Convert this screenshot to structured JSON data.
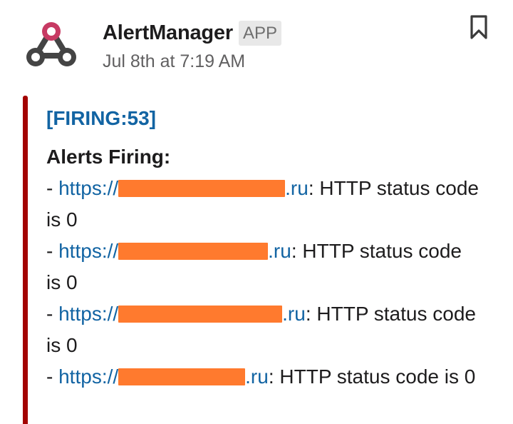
{
  "message": {
    "sender": "AlertManager",
    "badge": "APP",
    "timestamp": "Jul 8th at 7:19 AM"
  },
  "icons": {
    "avatar": "webhook-logo-icon",
    "bookmark": "bookmark-icon"
  },
  "colors": {
    "attachment_bar": "#a30200",
    "link": "#1264a3",
    "redaction": "#ff7a2e"
  },
  "attachment": {
    "title": "[FIRING:53]",
    "heading": "Alerts Firing:",
    "alerts": [
      {
        "prefix": "- ",
        "link_start": "https://",
        "link_end": ".ru",
        "text": ": HTTP status code is 0"
      },
      {
        "prefix": "- ",
        "link_start": "https://",
        "link_end": ".ru",
        "text": ": HTTP status code is 0"
      },
      {
        "prefix": "- ",
        "link_start": "https://",
        "link_end": ".ru",
        "text": ": HTTP status code is 0"
      },
      {
        "prefix": "- ",
        "link_start": "https://",
        "link_end": ".ru",
        "text": ": HTTP status code is 0"
      }
    ]
  }
}
